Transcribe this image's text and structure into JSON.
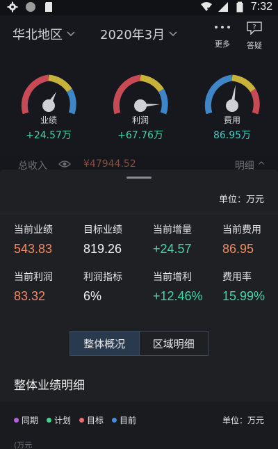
{
  "status_bar": {
    "time": "7:32"
  },
  "header": {
    "region": "华北地区",
    "month": "2020年3月",
    "more_label": "更多",
    "faq_label": "答疑"
  },
  "gauges": [
    {
      "label": "业绩",
      "value": "+24.57万",
      "color": "#41d3a4"
    },
    {
      "label": "利润",
      "value": "+67.76万",
      "color": "#41d3a4"
    },
    {
      "label": "费用",
      "value": "86.95万",
      "color": "#45c7c0"
    }
  ],
  "total": {
    "label": "总收入",
    "value": "¥47944.52",
    "detail_label": "明细"
  },
  "panel": {
    "unit": "单位：万元",
    "metrics": [
      {
        "label": "当前业绩",
        "value": "543.83",
        "color": "orange"
      },
      {
        "label": "目标业绩",
        "value": "819.26",
        "color": "white"
      },
      {
        "label": "当前增量",
        "value": "+24.57",
        "color": "mint"
      },
      {
        "label": "当前费用",
        "value": "86.95",
        "color": "orange"
      },
      {
        "label": "当前利润",
        "value": "83.32",
        "color": "orange"
      },
      {
        "label": "利润指标",
        "value": "6%",
        "color": "white"
      },
      {
        "label": "当前增利",
        "value": "+12.46%",
        "color": "mint"
      },
      {
        "label": "费用率",
        "value": "15.99%",
        "color": "mint"
      }
    ],
    "tabs": [
      {
        "label": "整体概况",
        "active": true
      },
      {
        "label": "区域明细",
        "active": false
      }
    ],
    "section_title": "整体业绩明细",
    "legend": [
      {
        "label": "同期",
        "color": "#b55ee0"
      },
      {
        "label": "计划",
        "color": "#3fd68c"
      },
      {
        "label": "目标",
        "color": "#f06a6a"
      },
      {
        "label": "目前",
        "color": "#3a8fe0"
      }
    ],
    "legend_unit": "单位：万元",
    "axis_unit": "(万元"
  }
}
